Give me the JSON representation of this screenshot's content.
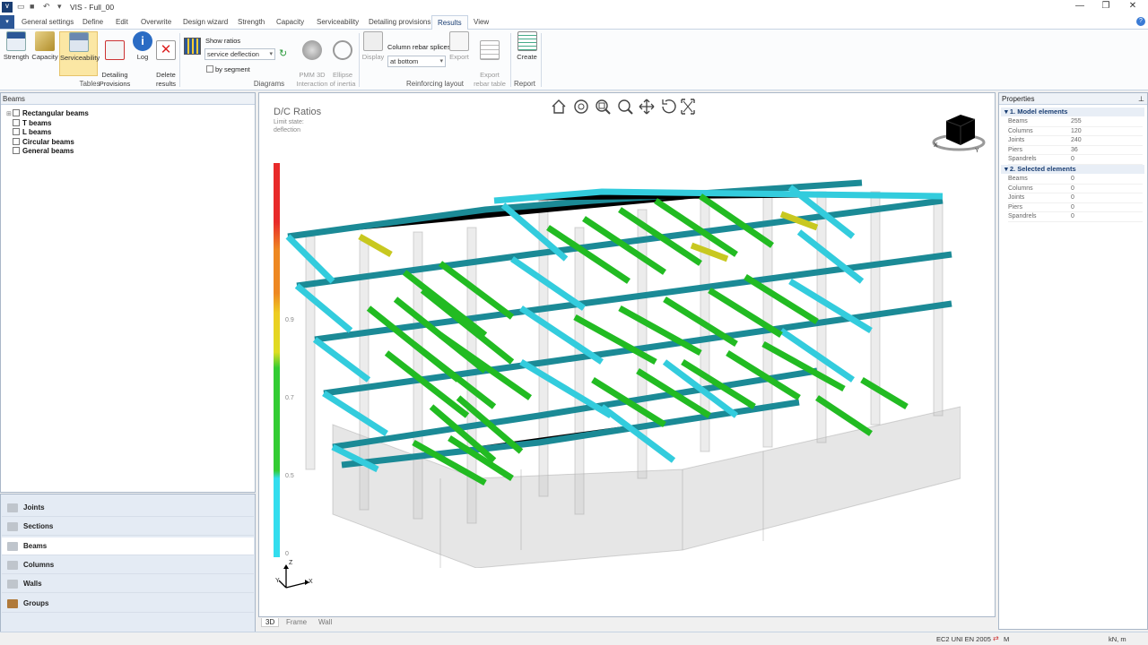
{
  "app": {
    "title": "VIS - Full_00"
  },
  "menu": {
    "tabs": [
      "General settings",
      "Define",
      "Edit",
      "Overwrite",
      "Design wizard",
      "Strength",
      "Capacity",
      "Serviceability",
      "Detailing provisions",
      "Results",
      "View"
    ],
    "active": "Results"
  },
  "ribbon": {
    "tables_buttons": [
      "Strength",
      "Capacity",
      "Serviceability",
      "Detailing\nProvisions",
      "Log",
      "Delete\nresults"
    ],
    "tables_group": "Tables",
    "show_ratios_label": "Show ratios",
    "show_ratios_value": "service deflection",
    "by_segment_label": "by segment",
    "pmm_label": "PMM 3D\nInteraction",
    "ellipse_label": "Ellipse\nof inertia",
    "diagrams_group": "Diagrams",
    "display_label": "Display",
    "column_rebar_label": "Column rebar splices",
    "column_rebar_value": "at bottom",
    "export_label": "Export",
    "export_table_label": "Export\nrebar table",
    "reinforcing_group": "Reinforcing layout",
    "create_label": "Create",
    "report_group": "Report"
  },
  "left_panel": {
    "title": "Beams",
    "tree": [
      "Rectangular beams",
      "T beams",
      "L beams",
      "Circular beams",
      "General beams"
    ]
  },
  "nav": {
    "items": [
      "Joints",
      "Sections",
      "Beams",
      "Columns",
      "Walls",
      "Groups"
    ],
    "selected": "Beams"
  },
  "viewport": {
    "title": "D/C Ratios",
    "subtitle1": "Limit state:",
    "subtitle2": "deflection",
    "legend_ticks": [
      "0.9",
      "0.7",
      "0.5",
      "0"
    ],
    "tabs": [
      "3D",
      "Frame",
      "Wall"
    ],
    "axis_labels": {
      "x": "X",
      "z": "Z",
      "y": "Y"
    }
  },
  "properties": {
    "title": "Properties",
    "sections": [
      {
        "name": "1. Model elements",
        "rows": [
          [
            "Beams",
            "255"
          ],
          [
            "Columns",
            "120"
          ],
          [
            "Joints",
            "240"
          ],
          [
            "Piers",
            "36"
          ],
          [
            "Spandrels",
            "0"
          ]
        ]
      },
      {
        "name": "2. Selected elements",
        "rows": [
          [
            "Beams",
            "0"
          ],
          [
            "Columns",
            "0"
          ],
          [
            "Joints",
            "0"
          ],
          [
            "Piers",
            "0"
          ],
          [
            "Spandrels",
            "0"
          ]
        ]
      }
    ]
  },
  "status": {
    "code": "EC2 UNI EN 2005",
    "mode": "M",
    "units": "kN, m"
  },
  "colors": {
    "teal": "#1b8a96",
    "cyan": "#33ccdd",
    "green": "#22bb22",
    "yellow": "#c8c820"
  }
}
